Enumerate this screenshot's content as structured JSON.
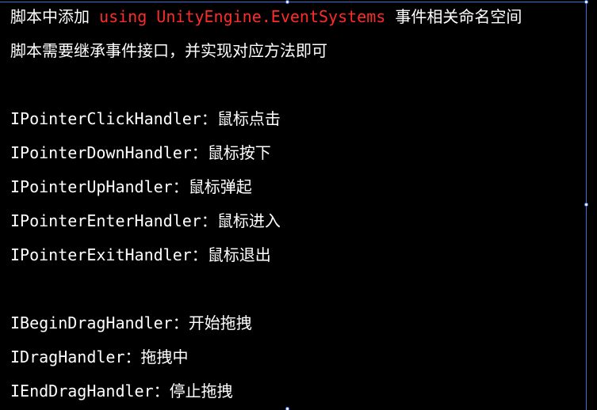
{
  "intro": {
    "line1_prefix": "脚本中添加 ",
    "line1_code": "using UnityEngine.EventSystems",
    "line1_suffix": " 事件相关命名空间",
    "line2": "脚本需要继承事件接口，并实现对应方法即可"
  },
  "pointer_handlers": [
    "IPointerClickHandler：鼠标点击",
    "IPointerDownHandler：鼠标按下",
    "IPointerUpHandler：鼠标弹起",
    "IPointerEnterHandler：鼠标进入",
    "IPointerExitHandler：鼠标退出"
  ],
  "drag_handlers": [
    "IBeginDragHandler：开始拖拽",
    "IDragHandler：拖拽中",
    "IEndDragHandler：停止拖拽"
  ],
  "colors": {
    "background": "#000000",
    "text": "#ffffff",
    "code": "#ff2a2a",
    "selection": "#3a6fd8"
  }
}
